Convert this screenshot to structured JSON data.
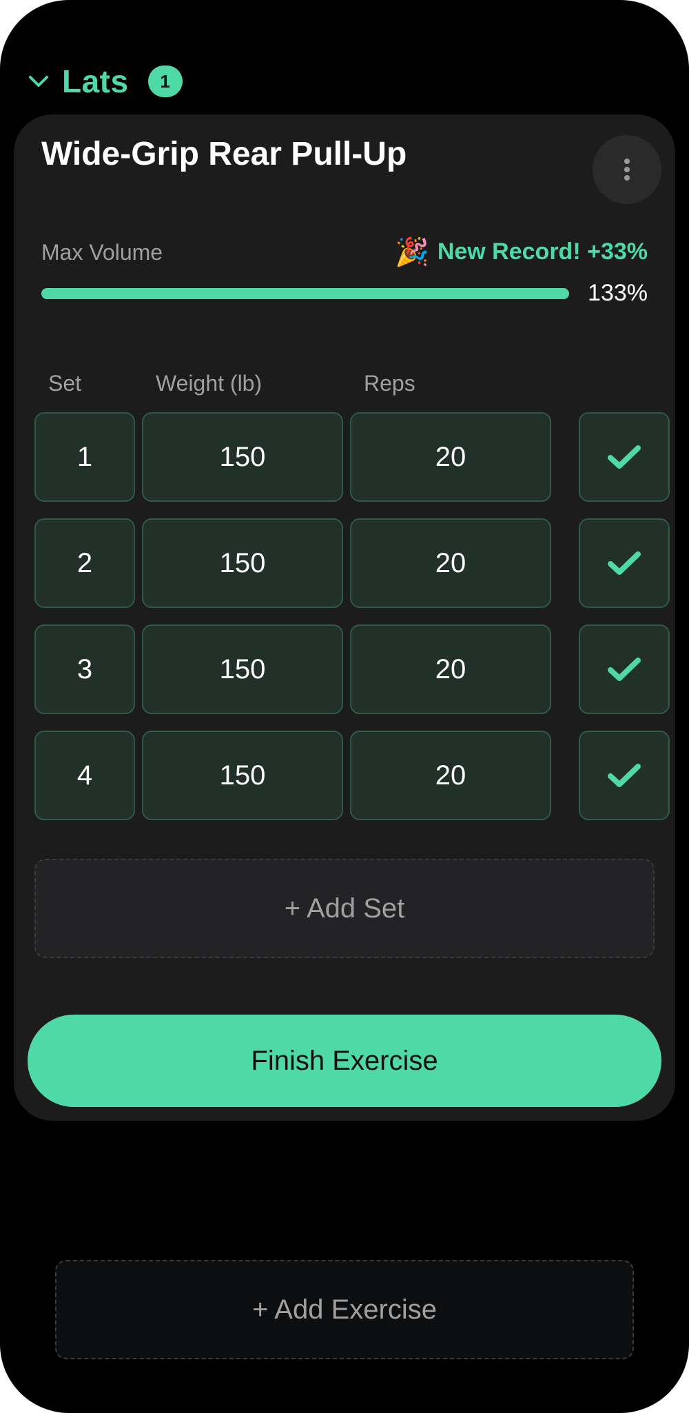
{
  "group": {
    "title": "Lats",
    "badge": "1"
  },
  "exercise": {
    "title": "Wide-Grip Rear Pull-Up",
    "volume_label": "Max Volume",
    "record_icon": "🎉",
    "record_text": "New Record! +33%",
    "progress_pct_text": "133%",
    "progress_fill_fraction": 1.0
  },
  "table": {
    "headers": {
      "set": "Set",
      "weight": "Weight (lb)",
      "reps": "Reps"
    },
    "rows": [
      {
        "set": "1",
        "weight": "150",
        "reps": "20",
        "completed": true
      },
      {
        "set": "2",
        "weight": "150",
        "reps": "20",
        "completed": true
      },
      {
        "set": "3",
        "weight": "150",
        "reps": "20",
        "completed": true
      },
      {
        "set": "4",
        "weight": "150",
        "reps": "20",
        "completed": true
      }
    ]
  },
  "actions": {
    "add_set": "+ Add Set",
    "finish": "Finish Exercise",
    "add_exercise": "+ Add Exercise"
  },
  "colors": {
    "accent": "#4fd9a7",
    "card_bg": "#1c1c1c",
    "cell_bg": "#213029",
    "cell_border": "#2f5a48"
  },
  "icons": {
    "chevron": "chevron-down-icon",
    "menu": "more-vertical-icon",
    "check": "check-icon"
  }
}
